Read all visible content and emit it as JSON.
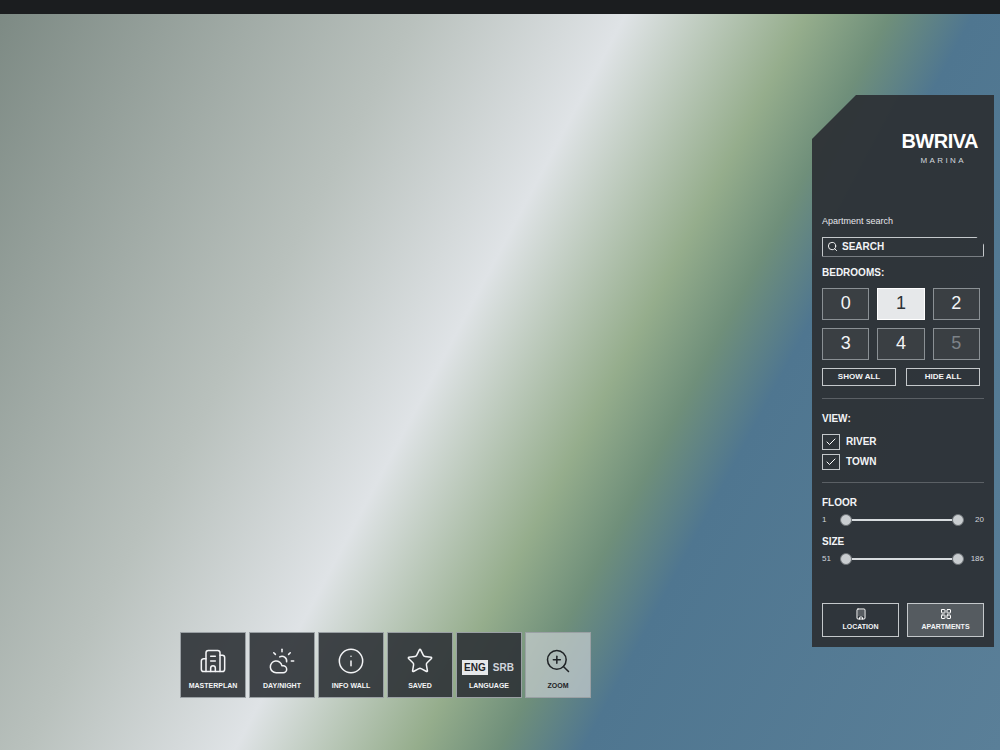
{
  "logo": {
    "name": "BWRIVA",
    "subtitle": "MARINA"
  },
  "panel": {
    "search_label": "Apartment search",
    "search_button": "SEARCH",
    "bedrooms_label": "BEDROOMS:",
    "bedrooms": [
      {
        "label": "0",
        "selected": false,
        "disabled": false
      },
      {
        "label": "1",
        "selected": true,
        "disabled": false
      },
      {
        "label": "2",
        "selected": false,
        "disabled": false
      },
      {
        "label": "3",
        "selected": false,
        "disabled": false
      },
      {
        "label": "4",
        "selected": false,
        "disabled": false
      },
      {
        "label": "5",
        "selected": false,
        "disabled": true
      }
    ],
    "show_all": "SHOW ALL",
    "hide_all": "HIDE ALL",
    "view_label": "VIEW:",
    "views": [
      {
        "label": "RIVER",
        "checked": true
      },
      {
        "label": "TOWN",
        "checked": true
      }
    ],
    "sliders": [
      {
        "label": "FLOOR",
        "min": "1",
        "max": "20",
        "low": 0,
        "high": 1
      },
      {
        "label": "SIZE",
        "min": "51",
        "max": "186",
        "low": 0,
        "high": 1
      }
    ],
    "buttons": [
      {
        "label": "LOCATION"
      },
      {
        "label": "APARTMENTS"
      }
    ]
  },
  "toolbar": [
    {
      "label": "MASTERPLAN",
      "kind": "icon",
      "selected": false
    },
    {
      "label": "DAY/NIGHT",
      "kind": "icon",
      "selected": false
    },
    {
      "label": "INFO WALL",
      "kind": "icon",
      "selected": false
    },
    {
      "label": "SAVED",
      "kind": "icon",
      "selected": false
    },
    {
      "label": "LANGUAGE",
      "kind": "language",
      "selected": false,
      "options": [
        {
          "label": "ENG",
          "selected": true
        },
        {
          "label": "SRB",
          "selected": false
        }
      ]
    },
    {
      "label": "ZOOM",
      "kind": "icon",
      "selected": true
    }
  ]
}
